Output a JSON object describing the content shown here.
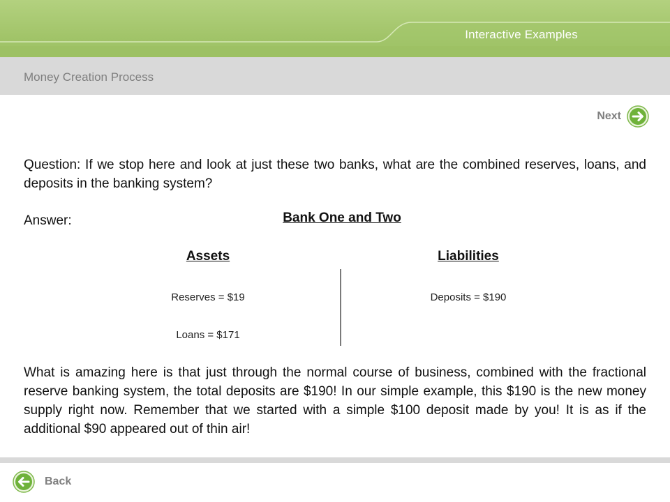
{
  "header": {
    "section_label": "Interactive Examples",
    "colors": {
      "banner": "#a6c86c",
      "banner_light": "#c6df96",
      "subheader": "#d9d9d9"
    }
  },
  "subheader": {
    "title": "Money Creation Process"
  },
  "navigation": {
    "next_label": "Next",
    "next_icon": "arrow-right-circle-icon",
    "back_label": "Back",
    "back_icon": "arrow-left-circle-icon",
    "icon_color": "#6fb23a"
  },
  "question": {
    "text": "Question:  If we stop here and look at just these two banks, what are the combined reserves, loans, and deposits in the banking system?"
  },
  "answer": {
    "label": "Answer:",
    "table_title": "Bank One and Two",
    "assets_header": "Assets",
    "liabilities_header": "Liabilities",
    "assets": [
      "Reserves = $19",
      "Loans = $171"
    ],
    "liabilities": [
      "Deposits = $190"
    ]
  },
  "explanation": {
    "text": "What is amazing here is that just through the normal course of business, combined with the fractional reserve banking system, the total deposits are $190! In our simple example, this $190 is the new money supply right now.  Remember that we started with a simple $100 deposit made by you! It is as if the additional $90 appeared out of thin air!"
  }
}
